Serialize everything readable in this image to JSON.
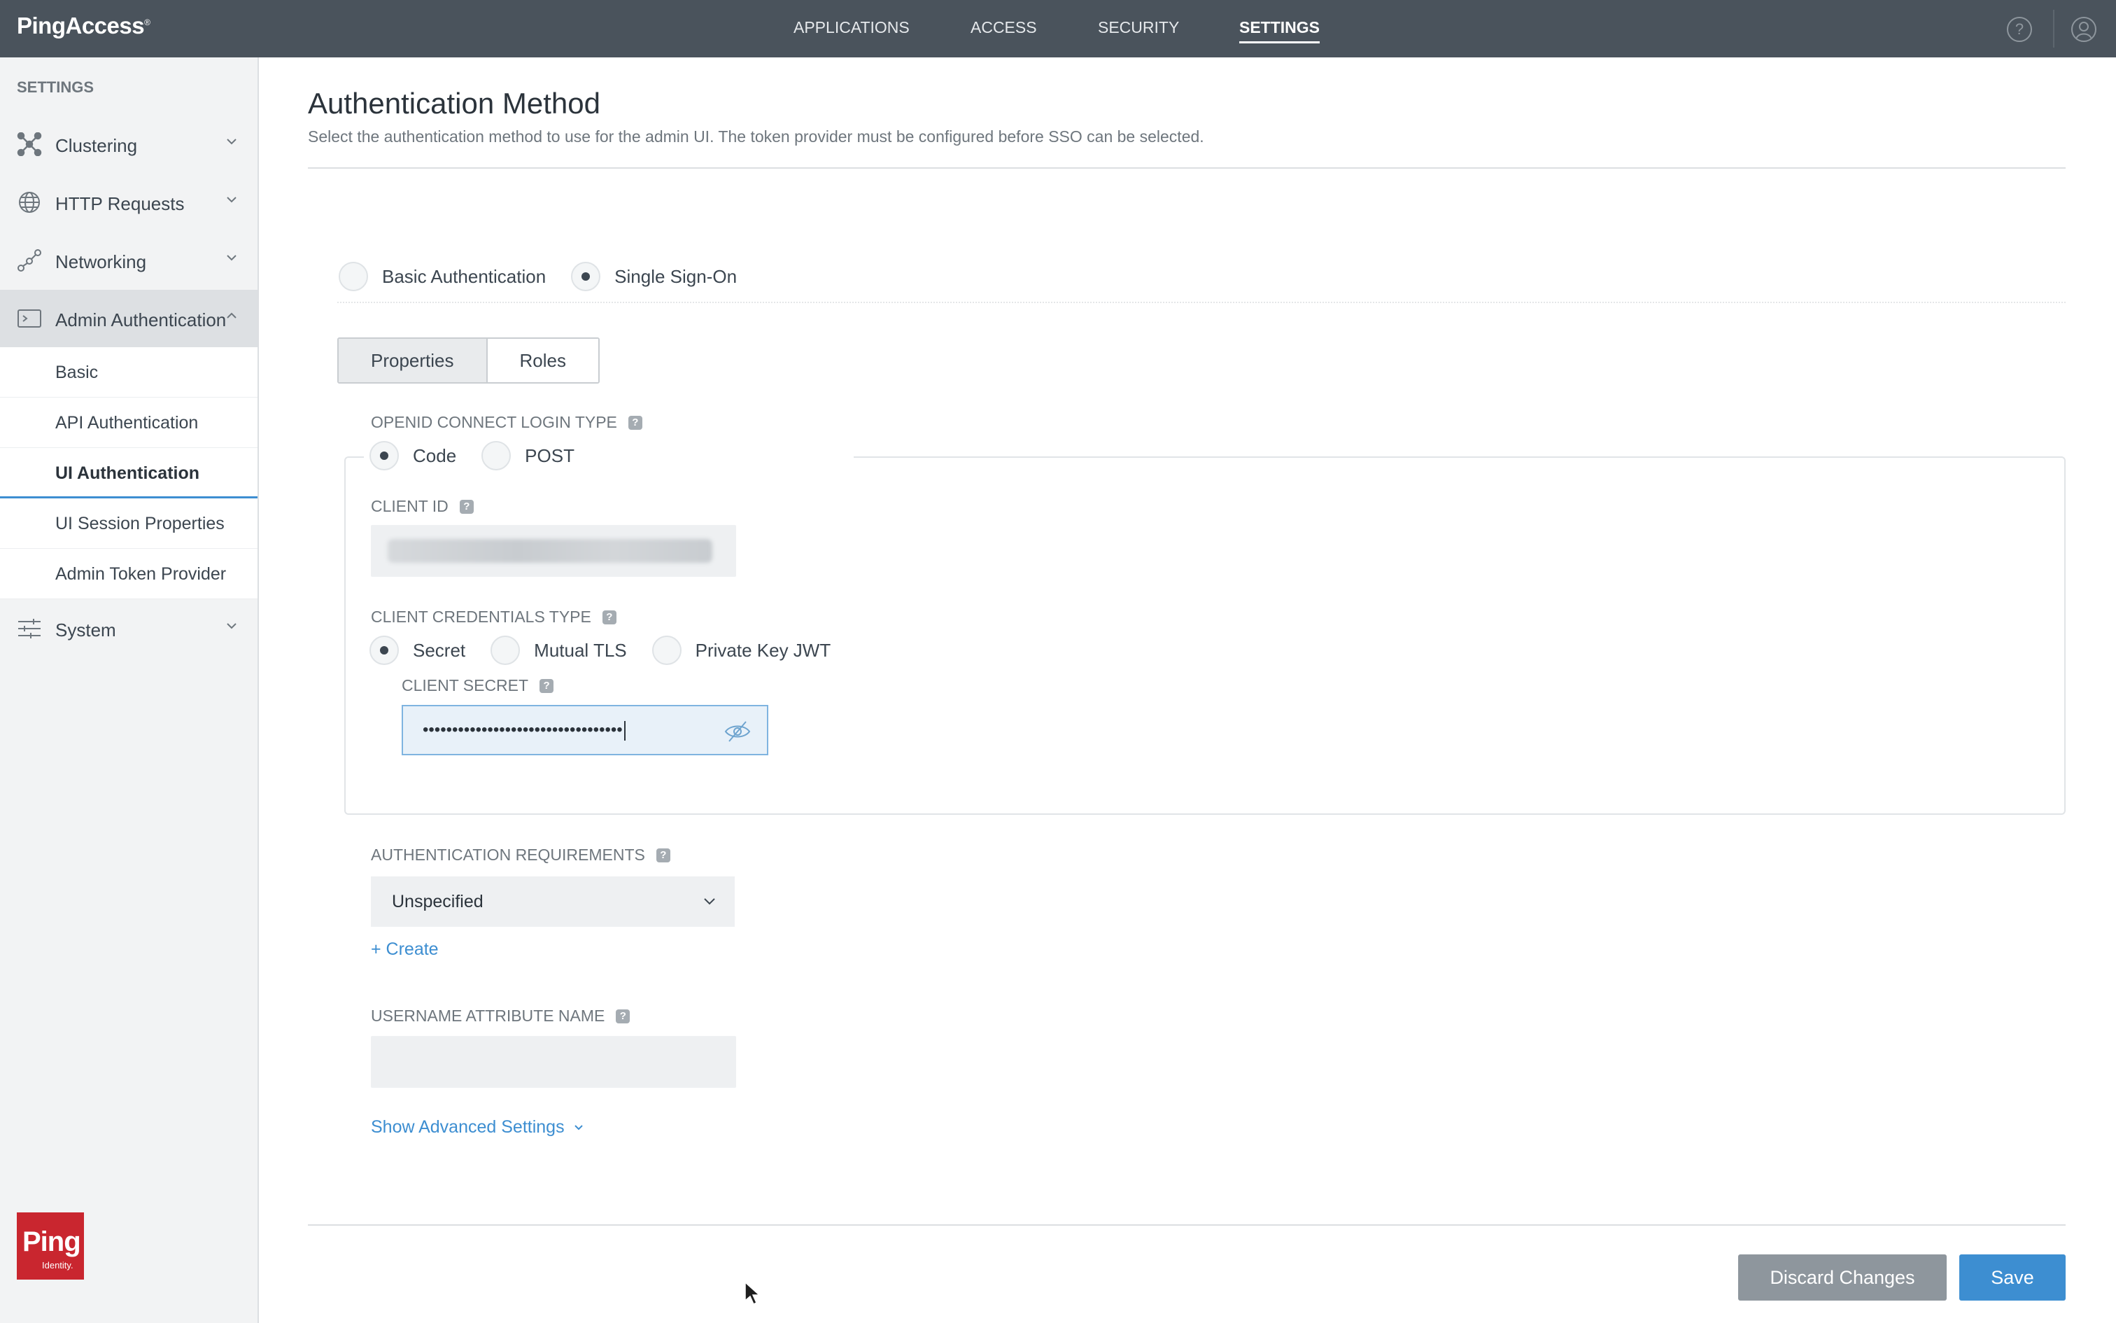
{
  "app": {
    "logo_text": "PingAccess",
    "logo_mark": "®"
  },
  "topnav": {
    "items": [
      {
        "label": "APPLICATIONS"
      },
      {
        "label": "ACCESS"
      },
      {
        "label": "SECURITY"
      },
      {
        "label": "SETTINGS",
        "active": true
      }
    ],
    "help_glyph": "?"
  },
  "sidebar": {
    "title": "SETTINGS",
    "items": [
      {
        "label": "Clustering",
        "icon": "clustering-icon"
      },
      {
        "label": "HTTP Requests",
        "icon": "globe-icon"
      },
      {
        "label": "Networking",
        "icon": "networking-icon"
      },
      {
        "label": "Admin Authentication",
        "icon": "terminal-icon",
        "expanded": true
      },
      {
        "label": "System",
        "icon": "sliders-icon"
      }
    ],
    "subitems": [
      {
        "label": "Basic"
      },
      {
        "label": "API Authentication"
      },
      {
        "label": "UI Authentication",
        "active": true
      },
      {
        "label": "UI Session Properties"
      },
      {
        "label": "Admin Token Provider"
      }
    ],
    "brand": {
      "word": "Ping",
      "sub": "Identity."
    }
  },
  "page": {
    "title": "Authentication Method",
    "description": "Select the authentication method to use for the admin UI. The token provider must be configured before SSO can be selected.",
    "auth_methods": [
      {
        "label": "Basic Authentication",
        "checked": false
      },
      {
        "label": "Single Sign-On",
        "checked": true
      }
    ],
    "tabs": [
      {
        "label": "Properties",
        "active": true
      },
      {
        "label": "Roles"
      }
    ],
    "help_glyph": "?",
    "login_type": {
      "label": "OPENID CONNECT LOGIN TYPE",
      "options": [
        {
          "label": "Code",
          "checked": true
        },
        {
          "label": "POST",
          "checked": false
        }
      ]
    },
    "client_id": {
      "label": "CLIENT ID"
    },
    "credentials_type": {
      "label": "CLIENT CREDENTIALS TYPE",
      "options": [
        {
          "label": "Secret",
          "checked": true
        },
        {
          "label": "Mutual TLS",
          "checked": false
        },
        {
          "label": "Private Key JWT",
          "checked": false
        }
      ]
    },
    "client_secret": {
      "label": "CLIENT SECRET",
      "value": "••••••••••••••••••••••••••••••••••"
    },
    "auth_requirements": {
      "label": "AUTHENTICATION REQUIREMENTS",
      "selected": "Unspecified",
      "create_link": "+ Create"
    },
    "username_attr": {
      "label": "USERNAME ATTRIBUTE NAME",
      "value": ""
    },
    "advanced_link": "Show Advanced Settings",
    "buttons": {
      "discard": "Discard Changes",
      "save": "Save"
    }
  },
  "colors": {
    "topbar": "#4a535c",
    "accent": "#3d8ed1",
    "brand_red": "#c9262f",
    "discard": "#8e969d"
  }
}
